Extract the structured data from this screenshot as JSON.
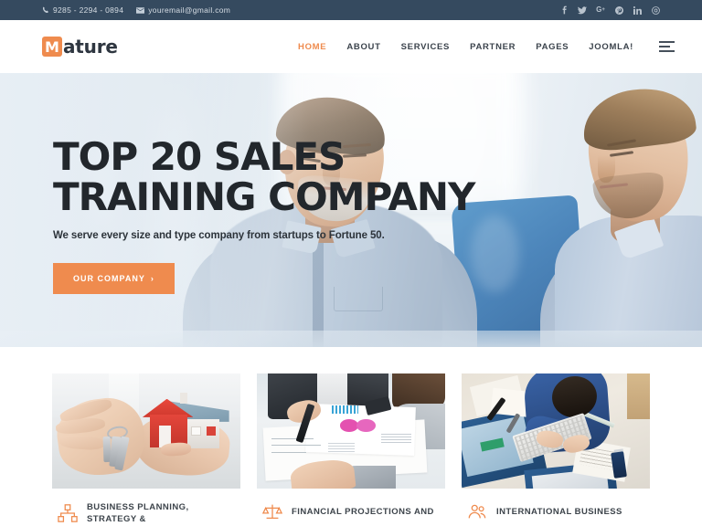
{
  "topbar": {
    "phone": "9285 - 2294 - 0894",
    "email": "youremail@gmail.com",
    "phone_icon": "phone-icon",
    "email_icon": "envelope-icon",
    "socials": [
      {
        "name": "facebook-icon",
        "glyph": "f"
      },
      {
        "name": "twitter-icon",
        "glyph": "t"
      },
      {
        "name": "google-plus-icon",
        "glyph": "G+"
      },
      {
        "name": "pinterest-icon",
        "glyph": "p"
      },
      {
        "name": "linkedin-icon",
        "glyph": "in"
      },
      {
        "name": "instagram-icon",
        "glyph": "o"
      }
    ],
    "bg_color": "#354a5f"
  },
  "header": {
    "logo_mark": "M",
    "logo_text": "ature",
    "accent_color": "#ef8b4e",
    "nav": [
      {
        "label": "HOME",
        "active": true
      },
      {
        "label": "ABOUT",
        "active": false
      },
      {
        "label": "SERVICES",
        "active": false
      },
      {
        "label": "PARTNER",
        "active": false
      },
      {
        "label": "PAGES",
        "active": false
      },
      {
        "label": "JOOMLA!",
        "active": false
      }
    ],
    "menu_toggle": "menu-toggle-icon"
  },
  "hero": {
    "title_line1": "TOP 20 SALES",
    "title_line2": "TRAINING COMPANY",
    "subtitle": "We serve every size and type company from startups to Fortune 50.",
    "button_label": "OUR COMPANY",
    "button_arrow": "›",
    "button_color": "#ef8b4e",
    "image_alt": "two businessmen reviewing work at a desk"
  },
  "cards": [
    {
      "title": "BUSINESS PLANNING, STRATEGY &",
      "icon": "sitemap-icon",
      "image_alt": "hands holding house keys and a model house"
    },
    {
      "title": "FINANCIAL PROJECTIONS AND",
      "icon": "balance-scale-icon",
      "image_alt": "business people reviewing financial charts and documents"
    },
    {
      "title": "INTERNATIONAL BUSINESS",
      "icon": "users-icon",
      "image_alt": "overhead view of person working at desk with keyboard"
    }
  ]
}
